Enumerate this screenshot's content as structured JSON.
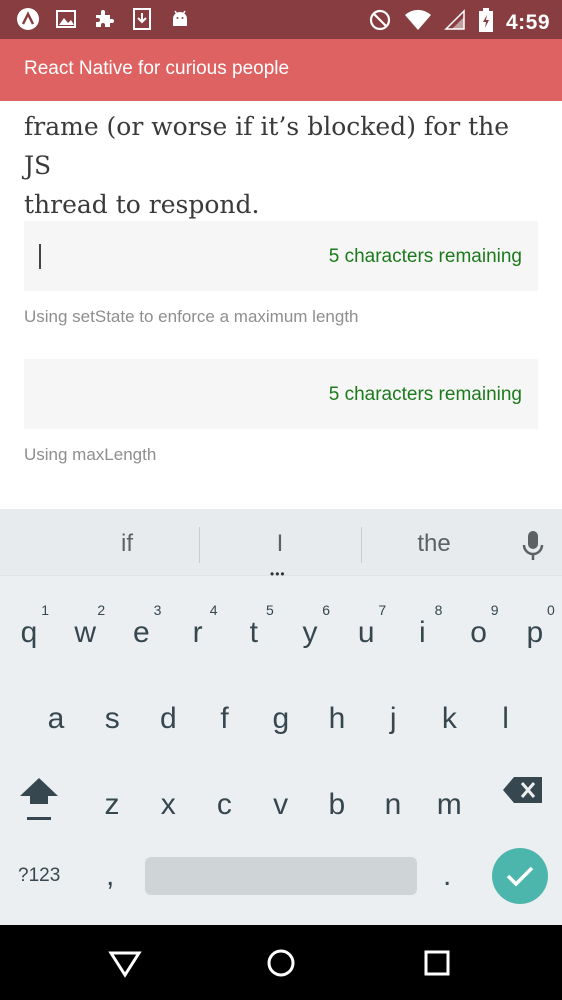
{
  "status_bar": {
    "time": "4:59",
    "left_icons": [
      "app-logo-icon",
      "image-icon",
      "puzzle-icon",
      "download-icon",
      "android-icon"
    ],
    "right_icons": [
      "do-not-disturb-icon",
      "wifi-icon",
      "signal-icon",
      "battery-icon"
    ]
  },
  "app_bar": {
    "title": "React Native for curious people",
    "color": "#df6262"
  },
  "content": {
    "paragraph_lines": [
      "frame (or worse if it’s blocked) for the JS",
      "thread to respond."
    ],
    "field1": {
      "value": "",
      "remaining": "5 characters remaining",
      "caption": "Using setState to enforce a maximum length"
    },
    "field2": {
      "value": "",
      "remaining": "5 characters remaining",
      "caption": "Using maxLength"
    }
  },
  "keyboard": {
    "suggestions": [
      "if",
      "I",
      "the"
    ],
    "row1": [
      {
        "k": "q",
        "n": "1"
      },
      {
        "k": "w",
        "n": "2"
      },
      {
        "k": "e",
        "n": "3"
      },
      {
        "k": "r",
        "n": "4"
      },
      {
        "k": "t",
        "n": "5"
      },
      {
        "k": "y",
        "n": "6"
      },
      {
        "k": "u",
        "n": "7"
      },
      {
        "k": "i",
        "n": "8"
      },
      {
        "k": "o",
        "n": "9"
      },
      {
        "k": "p",
        "n": "0"
      }
    ],
    "row2": [
      "a",
      "s",
      "d",
      "f",
      "g",
      "h",
      "j",
      "k",
      "l"
    ],
    "row3": [
      "z",
      "x",
      "c",
      "v",
      "b",
      "n",
      "m"
    ],
    "symbols_label": "?123",
    "comma": ",",
    "period": ".",
    "accent_color": "#4db6ac"
  }
}
